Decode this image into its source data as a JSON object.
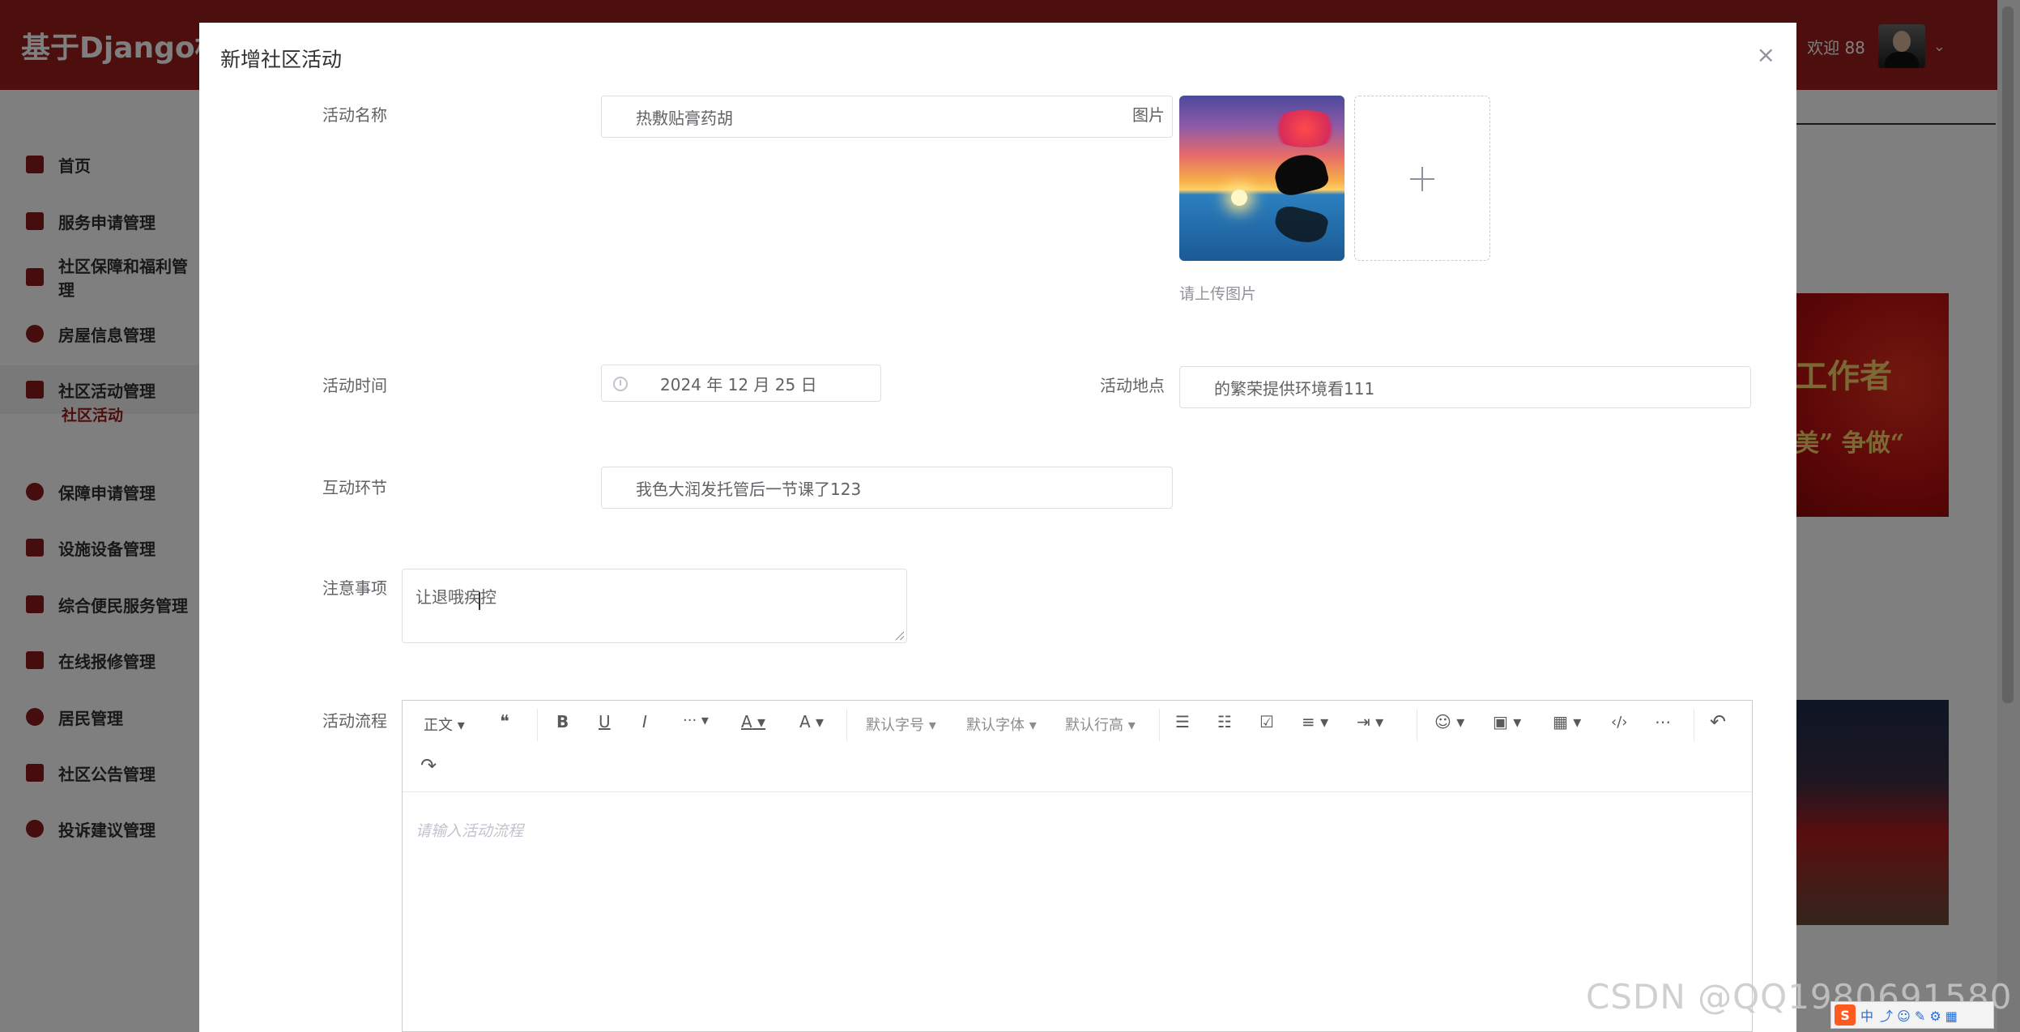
{
  "app": {
    "title": "基于Django框架",
    "welcome": "欢迎 88"
  },
  "sidebar": {
    "items": [
      {
        "label": "首页"
      },
      {
        "label": "服务申请管理"
      },
      {
        "label": "社区保障和福利管理"
      },
      {
        "label": "房屋信息管理"
      },
      {
        "label": "社区活动管理"
      },
      {
        "label": "保障申请管理"
      },
      {
        "label": "设施设备管理"
      },
      {
        "label": "综合便民服务管理"
      },
      {
        "label": "在线报修管理"
      },
      {
        "label": "居民管理"
      },
      {
        "label": "社区公告管理"
      },
      {
        "label": "投诉建议管理"
      }
    ],
    "subitem": "社区活动"
  },
  "banner": {
    "text1": "工作者",
    "text2": "美”  争做“"
  },
  "dialog": {
    "title": "新增社区活动",
    "close": "×",
    "labels": {
      "name": "活动名称",
      "image": "图片",
      "time": "活动时间",
      "place": "活动地点",
      "interaction": "互动环节",
      "notes": "注意事项",
      "process": "活动流程"
    },
    "values": {
      "name": "热敷贴膏药胡",
      "time": "2024 年 12 月 25 日",
      "place": "的繁荣提供环境看111",
      "interaction": "我色大润发托管后一节课了123",
      "notes": "让退哦疾控"
    },
    "upload_hint": "请上传图片"
  },
  "editor": {
    "toolbar": {
      "paragraph": "正文",
      "quote": "❝",
      "bold": "B",
      "underline": "U",
      "italic": "I",
      "more": "···",
      "font_color": "A",
      "bg_color": "A",
      "font_size": "默认字号",
      "font_family": "默认字体",
      "line_height": "默认行高",
      "bulleted_list": "☰",
      "numbered_list": "☷",
      "todo": "☑",
      "align": "≡",
      "indent": "⇥",
      "emoji": "☺",
      "image": "▣",
      "table": "▦",
      "code": "‹/›",
      "divider": "⋯",
      "undo": "↶",
      "redo": "↷"
    },
    "placeholder": "请输入活动流程"
  },
  "watermark": "CSDN @QQ1980691580",
  "ime": {
    "label": "中",
    "logo": "S"
  }
}
